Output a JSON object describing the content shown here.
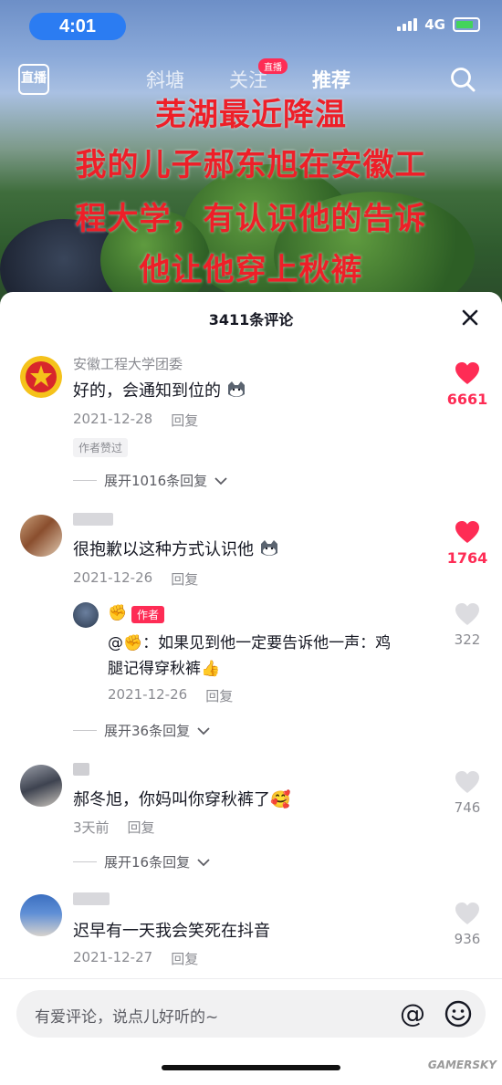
{
  "status_bar": {
    "time": "4:01",
    "network": "4G"
  },
  "top_nav": {
    "live_icon": "直播",
    "tabs": [
      "斜塘",
      "关注",
      "推荐"
    ],
    "live_badge": "直播",
    "active_tab": "推荐"
  },
  "video_caption": {
    "lines": [
      "芜湖最近降温",
      "我的儿子郝东旭在安徽工",
      "程大学，有认识他的告诉",
      "他让他穿上秋裤"
    ]
  },
  "comments_panel": {
    "title": "3411条评论",
    "comments": [
      {
        "username": "安徽工程大学团委",
        "text": "好的，会通知到位的",
        "date": "2021-12-28",
        "reply": "回复",
        "author_liked": "作者赞过",
        "likes": "6661",
        "expand": "展开1016条回复"
      },
      {
        "username": "",
        "text": "很抱歉以这种方式认识他",
        "date": "2021-12-26",
        "reply": "回复",
        "likes": "1764",
        "sub_reply": {
          "author_tag": "作者",
          "text_line1": "@✊：如果见到他一定要告诉他一声：鸡",
          "text_line2": "腿记得穿秋裤",
          "date": "2021-12-26",
          "reply": "回复",
          "likes": "322"
        },
        "expand": "展开36条回复"
      },
      {
        "username": "",
        "text": "郝冬旭，你妈叫你穿秋裤了",
        "date": "3天前",
        "reply": "回复",
        "likes": "746",
        "expand": "展开16条回复"
      },
      {
        "username": "",
        "text": "迟早有一天我会笑死在抖音",
        "date": "2021-12-27",
        "reply": "回复",
        "likes": "936"
      }
    ]
  },
  "input": {
    "placeholder": "有爱评论，说点儿好听的~",
    "at_symbol": "@"
  },
  "watermark": "GAMERSKY",
  "colors": {
    "like_red": "#fe2c55",
    "caption_red": "#ee1f28",
    "time_pill": "#2b7cf2"
  }
}
